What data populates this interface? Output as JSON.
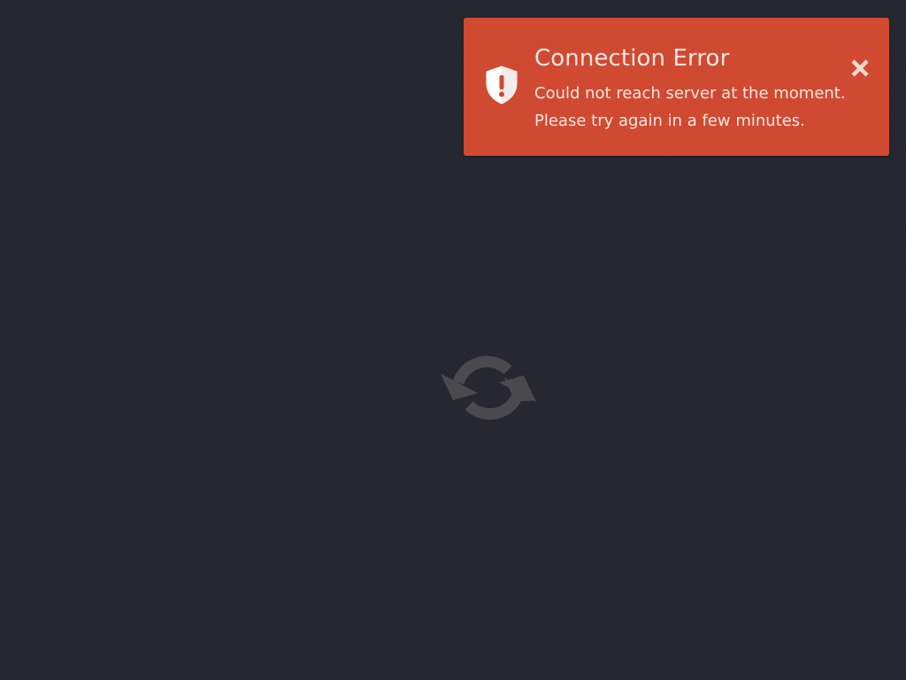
{
  "notification": {
    "title": "Connection Error",
    "message_lines": [
      "Could not reach server at the moment.",
      "Please try again in a few minutes."
    ],
    "icon": "shield-exclamation-icon",
    "close_icon": "close-icon",
    "color": "#cf4a31"
  },
  "loader": {
    "icon": "refresh-icon",
    "color": "#4a4a4e"
  },
  "background": {
    "color": "#25262f"
  }
}
